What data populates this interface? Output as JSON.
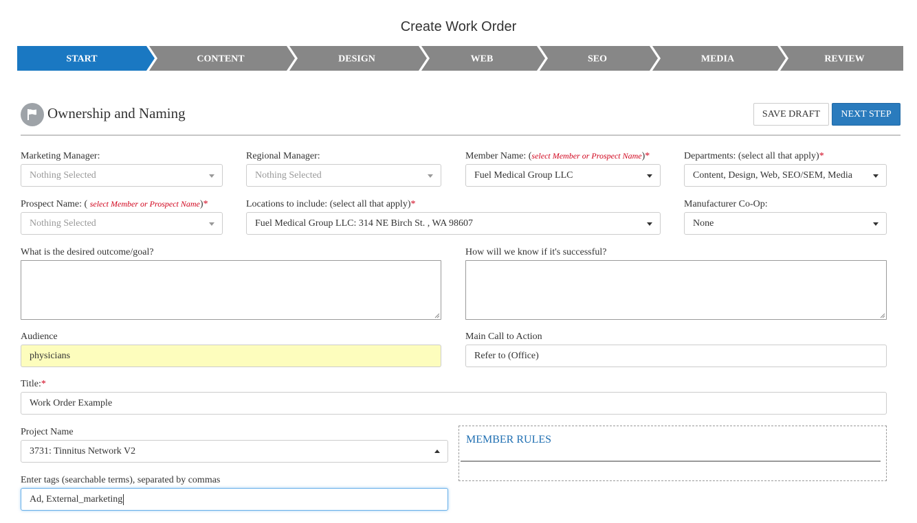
{
  "page": {
    "title": "Create Work Order"
  },
  "steps": [
    {
      "label": "START",
      "active": true
    },
    {
      "label": "CONTENT",
      "active": false
    },
    {
      "label": "DESIGN",
      "active": false
    },
    {
      "label": "WEB",
      "active": false
    },
    {
      "label": "SEO",
      "active": false
    },
    {
      "label": "MEDIA",
      "active": false
    },
    {
      "label": "REVIEW",
      "active": false
    }
  ],
  "colors": {
    "active_step": "#1a78c2",
    "inactive_step": "#878787",
    "primary_button": "#2a7bbd",
    "required": "#d0021b",
    "highlight": "#fdfdbd",
    "link": "#1f6fb2"
  },
  "section": {
    "icon": "flag-icon",
    "title": "Ownership and Naming"
  },
  "buttons": {
    "save_draft": "SAVE DRAFT",
    "next_step": "NEXT STEP"
  },
  "fields": {
    "marketing_manager": {
      "label": "Marketing Manager:",
      "value": "Nothing Selected"
    },
    "regional_manager": {
      "label": "Regional Manager:",
      "value": "Nothing Selected"
    },
    "member_name": {
      "label_prefix": "Member Name: (",
      "hint": "select Member or Prospect Name",
      "label_suffix": ")",
      "required": "*",
      "value": "Fuel Medical Group LLC"
    },
    "departments": {
      "label": "Departments: (select all that apply)",
      "required": "*",
      "value": "Content, Design, Web, SEO/SEM, Media"
    },
    "prospect_name": {
      "label_prefix": "Prospect Name: ( ",
      "hint": "select Member or Prospect Name",
      "label_suffix": ")",
      "required": "*",
      "value": "Nothing Selected"
    },
    "locations": {
      "label": "Locations to include: (select all that apply)",
      "required": "*",
      "value": "Fuel Medical Group LLC: 314 NE Birch St. , WA 98607"
    },
    "coop": {
      "label": "Manufacturer Co-Op:",
      "value": "None"
    },
    "goal": {
      "label": "What is the desired outcome/goal?"
    },
    "success": {
      "label": "How will we know if it's successful?"
    },
    "audience": {
      "label": "Audience",
      "value": "physicians"
    },
    "cta": {
      "label": "Main Call to Action",
      "value": "Refer to (Office)"
    },
    "title": {
      "label": "Title:",
      "required": "*",
      "value": "Work Order Example"
    },
    "project": {
      "label": "Project Name",
      "value": "3731: Tinnitus Network V2"
    },
    "tags": {
      "label": "Enter tags (searchable terms), separated by commas",
      "value": "Ad, External_marketing"
    }
  },
  "member_rules": {
    "title": "MEMBER RULES"
  }
}
